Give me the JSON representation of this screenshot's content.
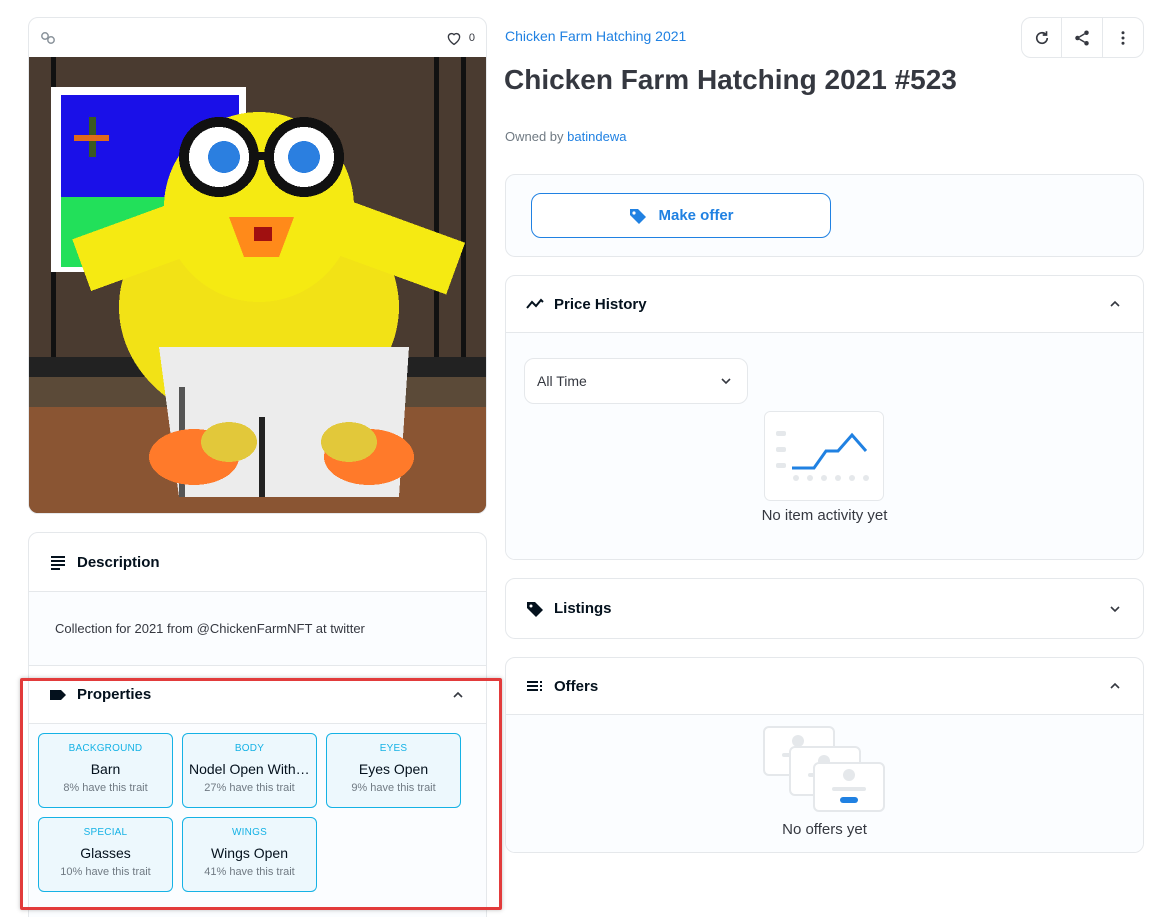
{
  "media": {
    "favorite_count": "0",
    "icons": {
      "chain": "link-icon",
      "favorite": "heart-icon"
    }
  },
  "description": {
    "heading": "Description",
    "text": "Collection for 2021 from @ChickenFarmNFT at twitter"
  },
  "properties": {
    "heading": "Properties",
    "traits": [
      {
        "type": "BACKGROUND",
        "value": "Barn",
        "rarity": "8% have this trait"
      },
      {
        "type": "BODY",
        "value": "Nodel Open With Hole",
        "rarity": "27% have this trait"
      },
      {
        "type": "EYES",
        "value": "Eyes Open",
        "rarity": "9% have this trait"
      },
      {
        "type": "SPECIAL",
        "value": "Glasses",
        "rarity": "10% have this trait"
      },
      {
        "type": "WINGS",
        "value": "Wings Open",
        "rarity": "41% have this trait"
      }
    ]
  },
  "item": {
    "collection": "Chicken Farm Hatching 2021",
    "title": "Chicken Farm Hatching 2021 #523",
    "owned_by_label": "Owned by",
    "owner": "batindewa"
  },
  "actions": {
    "refresh": "refresh-icon",
    "share": "share-icon",
    "more": "more-icon"
  },
  "offer": {
    "make_offer_label": "Make offer"
  },
  "price_history": {
    "heading": "Price History",
    "range_value": "All Time",
    "empty_text": "No item activity yet"
  },
  "listings": {
    "heading": "Listings"
  },
  "offers": {
    "heading": "Offers",
    "empty_text": "No offers yet"
  },
  "colors": {
    "accent": "#2081e2",
    "trait": "#15b2e5",
    "highlight": "#e23b3b"
  }
}
